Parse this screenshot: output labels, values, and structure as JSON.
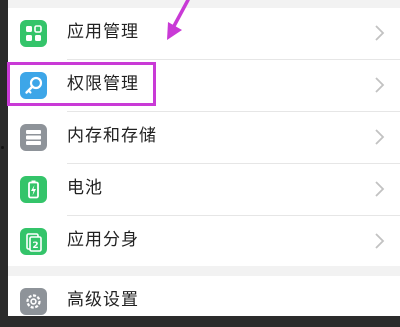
{
  "settings": {
    "items": [
      {
        "label": "应用管理",
        "icon": "apps-grid-icon",
        "color": "#34c46a"
      },
      {
        "label": "权限管理",
        "icon": "key-icon",
        "color": "#3da6e8"
      },
      {
        "label": "内存和存储",
        "icon": "storage-icon",
        "color": "#8e9399"
      },
      {
        "label": "电池",
        "icon": "battery-icon",
        "color": "#34c46a"
      },
      {
        "label": "应用分身",
        "icon": "app-clone-icon",
        "color": "#34c46a"
      },
      {
        "label": "高级设置",
        "icon": "gear-icon",
        "color": "#8e9399"
      }
    ]
  },
  "annotation": {
    "highlight_color": "#c93ad6"
  }
}
